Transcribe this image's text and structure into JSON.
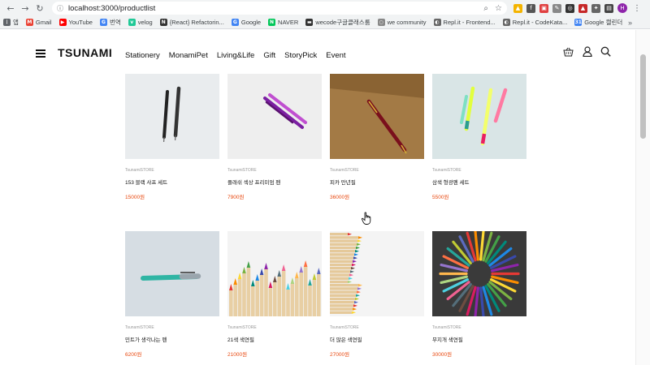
{
  "browser": {
    "url": "localhost:3000/productlist",
    "profile_initial": "H",
    "bookmarks": [
      {
        "label": "앱",
        "color": "#5f6368",
        "glyph": "⋮"
      },
      {
        "label": "Gmail",
        "color": "#ea4335",
        "glyph": "M"
      },
      {
        "label": "YouTube",
        "color": "#ff0000",
        "glyph": "▶"
      },
      {
        "label": "번역",
        "color": "#4285f4",
        "glyph": "G"
      },
      {
        "label": "velog",
        "color": "#20c997",
        "glyph": "v"
      },
      {
        "label": "{React} Refactorin...",
        "color": "#333333",
        "glyph": "N"
      },
      {
        "label": "Google",
        "color": "#4285f4",
        "glyph": "G"
      },
      {
        "label": "NAVER",
        "color": "#03c75a",
        "glyph": "N"
      },
      {
        "label": "wecode구글클래스룸",
        "color": "#333333",
        "glyph": "▬"
      },
      {
        "label": "we community",
        "color": "#888888",
        "glyph": "○"
      },
      {
        "label": "Repl.it - Frontend...",
        "color": "#666666",
        "glyph": "◐"
      },
      {
        "label": "Repl.it - CodeKata...",
        "color": "#666666",
        "glyph": "◐"
      },
      {
        "label": "Google 캘린더",
        "color": "#4285f4",
        "glyph": "31"
      }
    ],
    "bookmarks_more": "»"
  },
  "site": {
    "logo": "TSUNAMI",
    "nav": [
      "Stationery",
      "MonamiPet",
      "Living&Life",
      "Gift",
      "StoryPick",
      "Event"
    ]
  },
  "products": [
    {
      "brand": "TsunamiSTORE",
      "name": "153 블랙 샤프 세트",
      "price": "15000원",
      "image": "black-pens"
    },
    {
      "brand": "TsunamiSTORE",
      "name": "플래쉬 섹상 프리미엄 펜",
      "price": "7900원",
      "image": "purple-pens"
    },
    {
      "brand": "TsunamiSTORE",
      "name": "피카 만년필",
      "price": "36000원",
      "image": "fountain-pen"
    },
    {
      "brand": "TsunamiSTORE",
      "name": "삼색 형광펜 세트",
      "price": "5500원",
      "image": "highlighters"
    },
    {
      "brand": "TsunamiSTORE",
      "name": "민트가 생각나는 펜",
      "price": "6200원",
      "image": "mint-pen"
    },
    {
      "brand": "TsunamiSTORE",
      "name": "21색 색연필",
      "price": "21000원",
      "image": "colored-pencils-row"
    },
    {
      "brand": "TsunamiSTORE",
      "name": "더 많은 색연필",
      "price": "27000원",
      "image": "colored-pencils-stack"
    },
    {
      "brand": "TsunamiSTORE",
      "name": "무지개 색연필",
      "price": "30000원",
      "image": "rainbow-pencils-circle"
    }
  ]
}
